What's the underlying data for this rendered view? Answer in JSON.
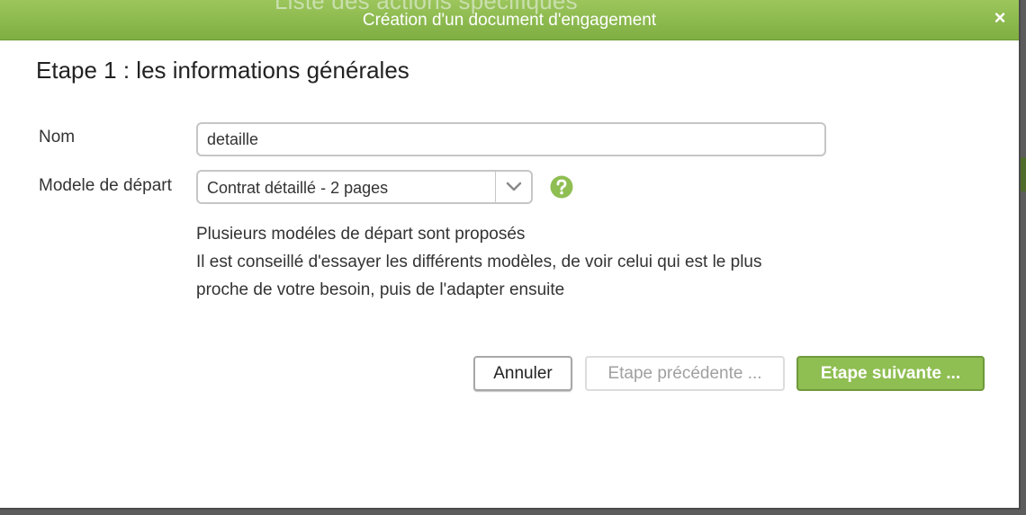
{
  "dialog": {
    "title": "Création d'un document d'engagement",
    "close_label": "×"
  },
  "background": {
    "partial_heading": "Liste des actions spécifiques"
  },
  "step": {
    "title": "Etape 1 : les informations générales"
  },
  "form": {
    "nom_label": "Nom",
    "nom_value": "detaille",
    "modele_label": "Modele de départ",
    "modele_value": "Contrat détaillé - 2 pages",
    "help_icon": "question-circle-icon"
  },
  "description": {
    "line1": "Plusieurs modéles de départ sont proposés",
    "line2": "Il est conseillé d'essayer les différents modèles, de voir celui qui est le plus",
    "line3": "proche de votre besoin, puis de l'adapter ensuite"
  },
  "buttons": {
    "cancel": "Annuler",
    "previous": "Etape précédente ...",
    "next": "Etape suivante ..."
  },
  "colors": {
    "accent": "#8fbe52",
    "titlebar": "#86b44a"
  }
}
